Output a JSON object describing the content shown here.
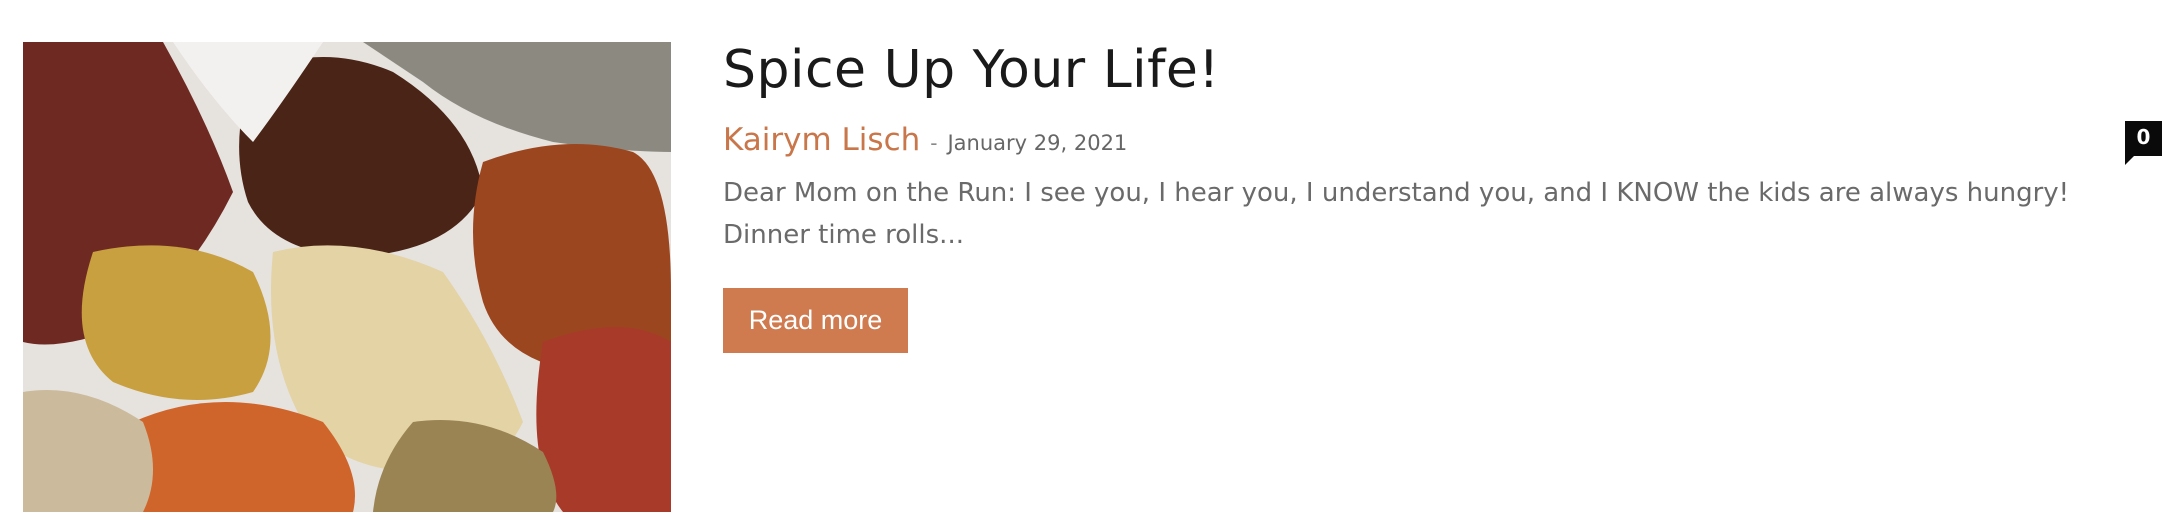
{
  "post": {
    "title": "Spice Up Your Life!",
    "author": "Kairym Lisch",
    "separator": "-",
    "date": "January 29, 2021",
    "comment_count": "0",
    "excerpt": "Dear Mom on the Run: I see you, I hear you, I understand you, and I KNOW the kids are always hungry!  Dinner time rolls...",
    "read_more_label": "Read more"
  },
  "colors": {
    "accent": "#cf7a4f",
    "author_link": "#c8764a",
    "title": "#1a1a1a",
    "text": "#6a6a6a",
    "badge": "#0a0a0a"
  },
  "icons": {
    "thumbnail": "spices-photo"
  }
}
